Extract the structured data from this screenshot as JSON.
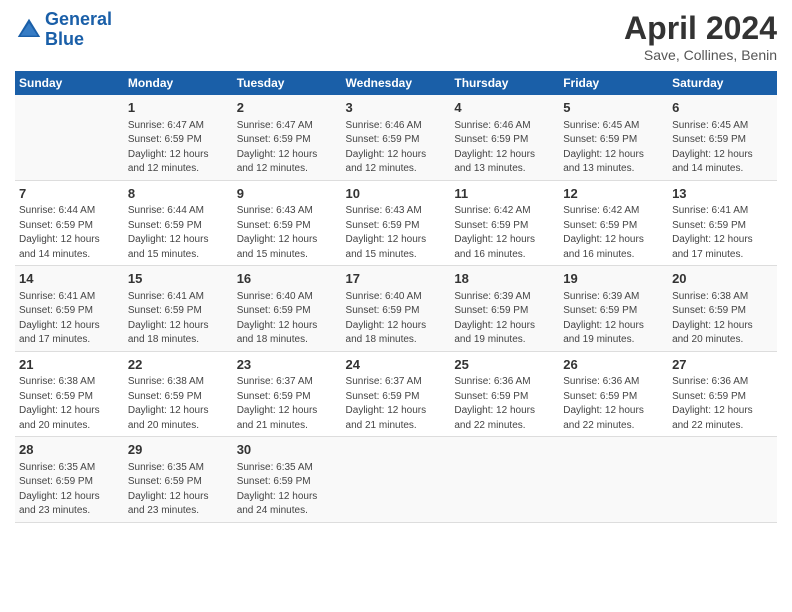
{
  "header": {
    "logo_line1": "General",
    "logo_line2": "Blue",
    "month": "April 2024",
    "location": "Save, Collines, Benin"
  },
  "weekdays": [
    "Sunday",
    "Monday",
    "Tuesday",
    "Wednesday",
    "Thursday",
    "Friday",
    "Saturday"
  ],
  "weeks": [
    [
      {
        "day": "",
        "info": ""
      },
      {
        "day": "1",
        "info": "Sunrise: 6:47 AM\nSunset: 6:59 PM\nDaylight: 12 hours\nand 12 minutes."
      },
      {
        "day": "2",
        "info": "Sunrise: 6:47 AM\nSunset: 6:59 PM\nDaylight: 12 hours\nand 12 minutes."
      },
      {
        "day": "3",
        "info": "Sunrise: 6:46 AM\nSunset: 6:59 PM\nDaylight: 12 hours\nand 12 minutes."
      },
      {
        "day": "4",
        "info": "Sunrise: 6:46 AM\nSunset: 6:59 PM\nDaylight: 12 hours\nand 13 minutes."
      },
      {
        "day": "5",
        "info": "Sunrise: 6:45 AM\nSunset: 6:59 PM\nDaylight: 12 hours\nand 13 minutes."
      },
      {
        "day": "6",
        "info": "Sunrise: 6:45 AM\nSunset: 6:59 PM\nDaylight: 12 hours\nand 14 minutes."
      }
    ],
    [
      {
        "day": "7",
        "info": "Sunrise: 6:44 AM\nSunset: 6:59 PM\nDaylight: 12 hours\nand 14 minutes."
      },
      {
        "day": "8",
        "info": "Sunrise: 6:44 AM\nSunset: 6:59 PM\nDaylight: 12 hours\nand 15 minutes."
      },
      {
        "day": "9",
        "info": "Sunrise: 6:43 AM\nSunset: 6:59 PM\nDaylight: 12 hours\nand 15 minutes."
      },
      {
        "day": "10",
        "info": "Sunrise: 6:43 AM\nSunset: 6:59 PM\nDaylight: 12 hours\nand 15 minutes."
      },
      {
        "day": "11",
        "info": "Sunrise: 6:42 AM\nSunset: 6:59 PM\nDaylight: 12 hours\nand 16 minutes."
      },
      {
        "day": "12",
        "info": "Sunrise: 6:42 AM\nSunset: 6:59 PM\nDaylight: 12 hours\nand 16 minutes."
      },
      {
        "day": "13",
        "info": "Sunrise: 6:41 AM\nSunset: 6:59 PM\nDaylight: 12 hours\nand 17 minutes."
      }
    ],
    [
      {
        "day": "14",
        "info": "Sunrise: 6:41 AM\nSunset: 6:59 PM\nDaylight: 12 hours\nand 17 minutes."
      },
      {
        "day": "15",
        "info": "Sunrise: 6:41 AM\nSunset: 6:59 PM\nDaylight: 12 hours\nand 18 minutes."
      },
      {
        "day": "16",
        "info": "Sunrise: 6:40 AM\nSunset: 6:59 PM\nDaylight: 12 hours\nand 18 minutes."
      },
      {
        "day": "17",
        "info": "Sunrise: 6:40 AM\nSunset: 6:59 PM\nDaylight: 12 hours\nand 18 minutes."
      },
      {
        "day": "18",
        "info": "Sunrise: 6:39 AM\nSunset: 6:59 PM\nDaylight: 12 hours\nand 19 minutes."
      },
      {
        "day": "19",
        "info": "Sunrise: 6:39 AM\nSunset: 6:59 PM\nDaylight: 12 hours\nand 19 minutes."
      },
      {
        "day": "20",
        "info": "Sunrise: 6:38 AM\nSunset: 6:59 PM\nDaylight: 12 hours\nand 20 minutes."
      }
    ],
    [
      {
        "day": "21",
        "info": "Sunrise: 6:38 AM\nSunset: 6:59 PM\nDaylight: 12 hours\nand 20 minutes."
      },
      {
        "day": "22",
        "info": "Sunrise: 6:38 AM\nSunset: 6:59 PM\nDaylight: 12 hours\nand 20 minutes."
      },
      {
        "day": "23",
        "info": "Sunrise: 6:37 AM\nSunset: 6:59 PM\nDaylight: 12 hours\nand 21 minutes."
      },
      {
        "day": "24",
        "info": "Sunrise: 6:37 AM\nSunset: 6:59 PM\nDaylight: 12 hours\nand 21 minutes."
      },
      {
        "day": "25",
        "info": "Sunrise: 6:36 AM\nSunset: 6:59 PM\nDaylight: 12 hours\nand 22 minutes."
      },
      {
        "day": "26",
        "info": "Sunrise: 6:36 AM\nSunset: 6:59 PM\nDaylight: 12 hours\nand 22 minutes."
      },
      {
        "day": "27",
        "info": "Sunrise: 6:36 AM\nSunset: 6:59 PM\nDaylight: 12 hours\nand 22 minutes."
      }
    ],
    [
      {
        "day": "28",
        "info": "Sunrise: 6:35 AM\nSunset: 6:59 PM\nDaylight: 12 hours\nand 23 minutes."
      },
      {
        "day": "29",
        "info": "Sunrise: 6:35 AM\nSunset: 6:59 PM\nDaylight: 12 hours\nand 23 minutes."
      },
      {
        "day": "30",
        "info": "Sunrise: 6:35 AM\nSunset: 6:59 PM\nDaylight: 12 hours\nand 24 minutes."
      },
      {
        "day": "",
        "info": ""
      },
      {
        "day": "",
        "info": ""
      },
      {
        "day": "",
        "info": ""
      },
      {
        "day": "",
        "info": ""
      }
    ]
  ]
}
